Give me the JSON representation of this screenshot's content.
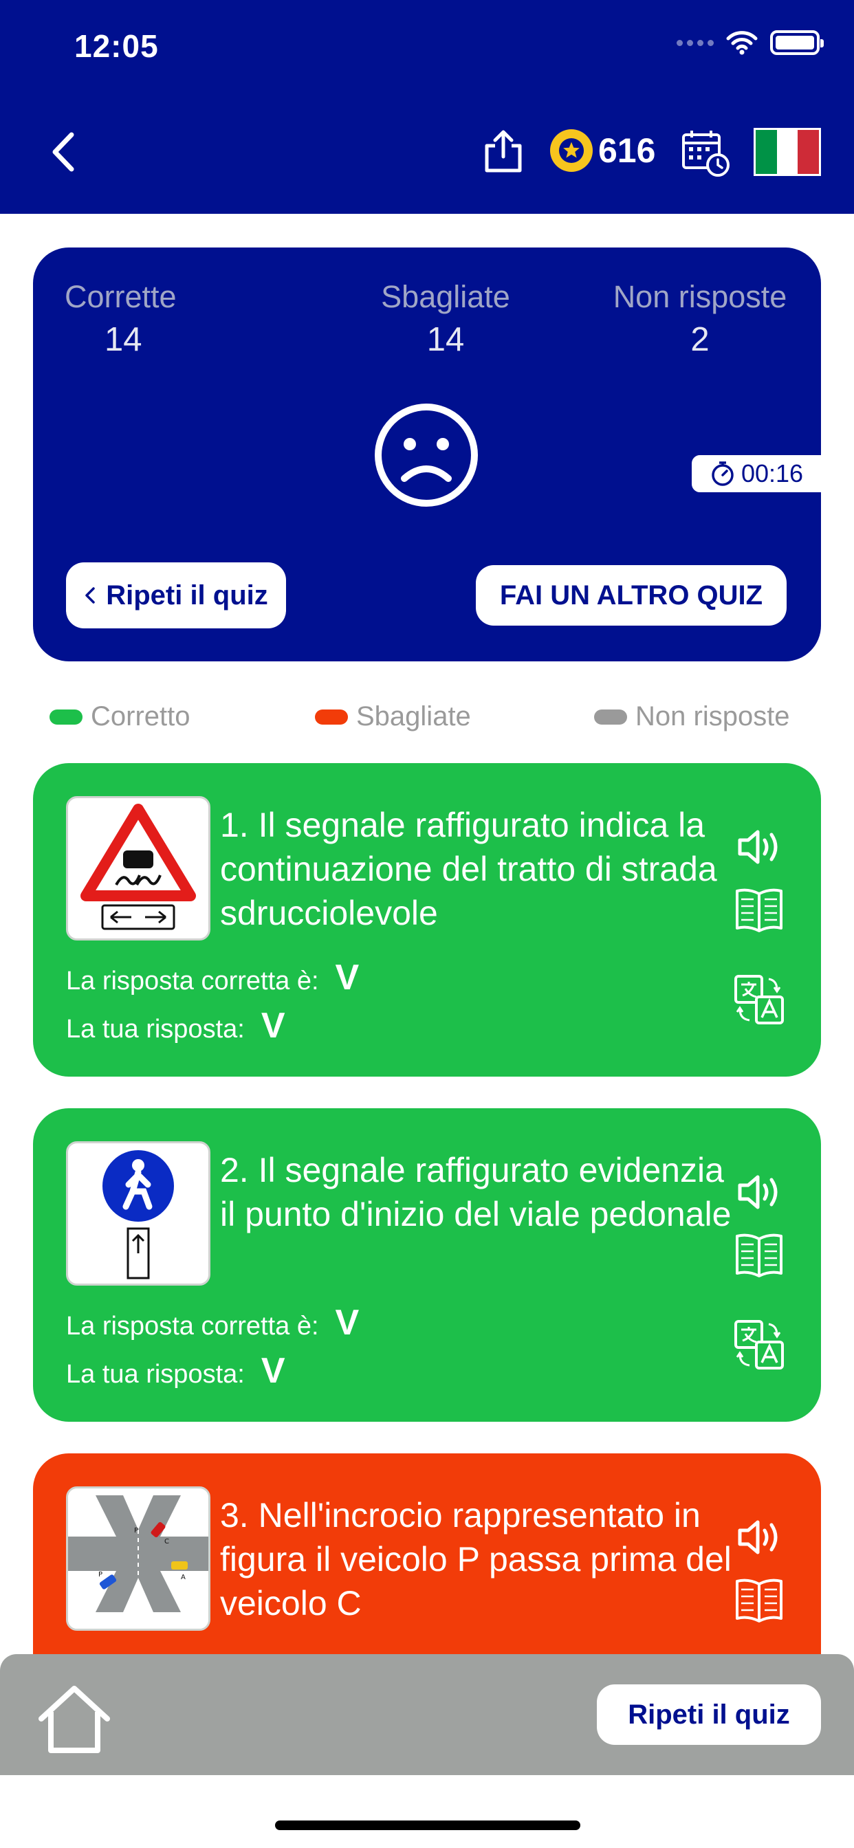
{
  "status_bar": {
    "time": "12:05"
  },
  "header": {
    "coins": "616",
    "colors": {
      "background": "#00108f",
      "coin": "#f7c51e"
    },
    "flag_colors": [
      "#009246",
      "#ffffff",
      "#ce2b37"
    ],
    "icons": [
      "back-chevron-icon",
      "share-icon",
      "star-coin-icon",
      "calendar-clock-icon",
      "italy-flag-icon"
    ]
  },
  "score": {
    "correct_label": "Corrette",
    "correct_value": "14",
    "wrong_label": "Sbagliate",
    "wrong_value": "14",
    "unanswered_label": "Non risposte",
    "unanswered_value": "2",
    "timer": "00:16",
    "repeat_button": "Ripeti il quiz",
    "another_button": "FAI UN ALTRO QUIZ"
  },
  "legend": {
    "correct": "Corretto",
    "wrong": "Sbagliate",
    "unanswered": "Non risposte",
    "colors": {
      "correct": "#1dbf4a",
      "wrong": "#f23c09",
      "unanswered": "#9a9a9a"
    }
  },
  "questions": [
    {
      "number_text": "1. Il segnale raffigurato indica la continuazione del tratto di strada sdrucciolevole",
      "correct_label": "La risposta corretta è:",
      "correct_answer": "V",
      "user_label": "La tua risposta:",
      "user_answer": "V",
      "status": "correct",
      "color": "#1dbf4a"
    },
    {
      "number_text": "2. Il segnale raffigurato evidenzia il punto d'inizio del viale pedonale",
      "correct_label": "La risposta corretta è:",
      "correct_answer": "V",
      "user_label": "La tua risposta:",
      "user_answer": "V",
      "status": "correct",
      "color": "#1dbf4a"
    },
    {
      "number_text": "3. Nell'incrocio rappresentato in figura il veicolo P passa prima del veicolo C",
      "status": "wrong",
      "color": "#f23c09"
    }
  ],
  "bottom_bar": {
    "repeat_button": "Ripeti il quiz"
  }
}
